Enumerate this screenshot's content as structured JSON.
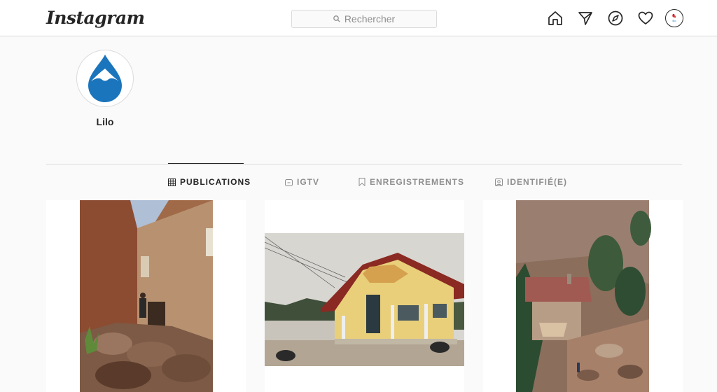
{
  "header": {
    "logo": "Instagram",
    "search_placeholder": "Rechercher"
  },
  "profile": {
    "username": "Lilo"
  },
  "tabs": [
    {
      "label": "PUBLICATIONS",
      "active": true
    },
    {
      "label": "IGTV",
      "active": false
    },
    {
      "label": "ENREGISTREMENTS",
      "active": false
    },
    {
      "label": "IDENTIFIÉ(E)",
      "active": false
    }
  ],
  "colors": {
    "accent_blue": "#1b75bc",
    "border": "#dbdbdb",
    "text": "#262626",
    "muted": "#8e8e8e"
  },
  "icons": [
    "home-icon",
    "direct-message-icon",
    "explore-icon",
    "activity-heart-icon",
    "search-icon",
    "grid-icon",
    "igtv-icon",
    "bookmark-icon",
    "tagged-icon"
  ]
}
